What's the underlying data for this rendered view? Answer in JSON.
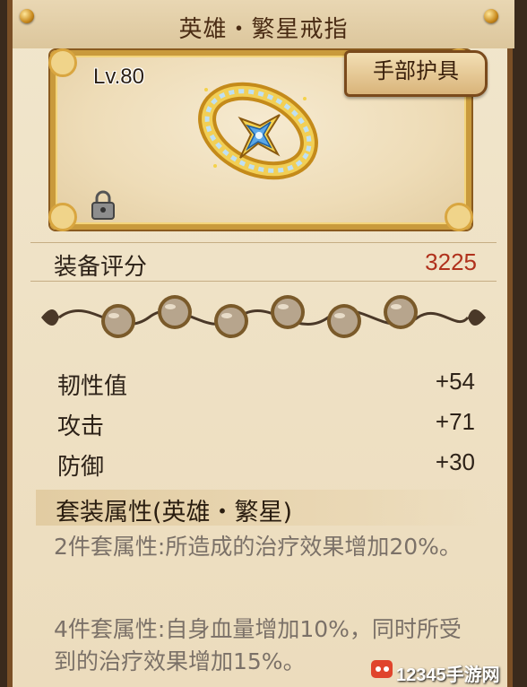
{
  "header": {
    "title": "英雄・繁星戒指"
  },
  "item": {
    "level": "Lv.80",
    "slot": "手部护具",
    "locked": true,
    "icon": "star-ring"
  },
  "score": {
    "label": "装备评分",
    "value": "3225"
  },
  "gems": {
    "count": 6
  },
  "attributes": [
    {
      "name": "韧性值",
      "value": "+54"
    },
    {
      "name": "攻击",
      "value": "+71"
    },
    {
      "name": "防御",
      "value": "+30"
    }
  ],
  "set": {
    "header": "套装属性(英雄・繁星)",
    "bonus2": "2件套属性:所造成的治疗效果增加20%。",
    "bonus4": "4件套属性:自身血量增加10%，同时所受到的治疗效果增加15%。"
  },
  "watermark": {
    "text": "12345手游网"
  },
  "colors": {
    "score": "#b0311c",
    "frame": "#c99a3c",
    "panel": "#efe2c6"
  }
}
